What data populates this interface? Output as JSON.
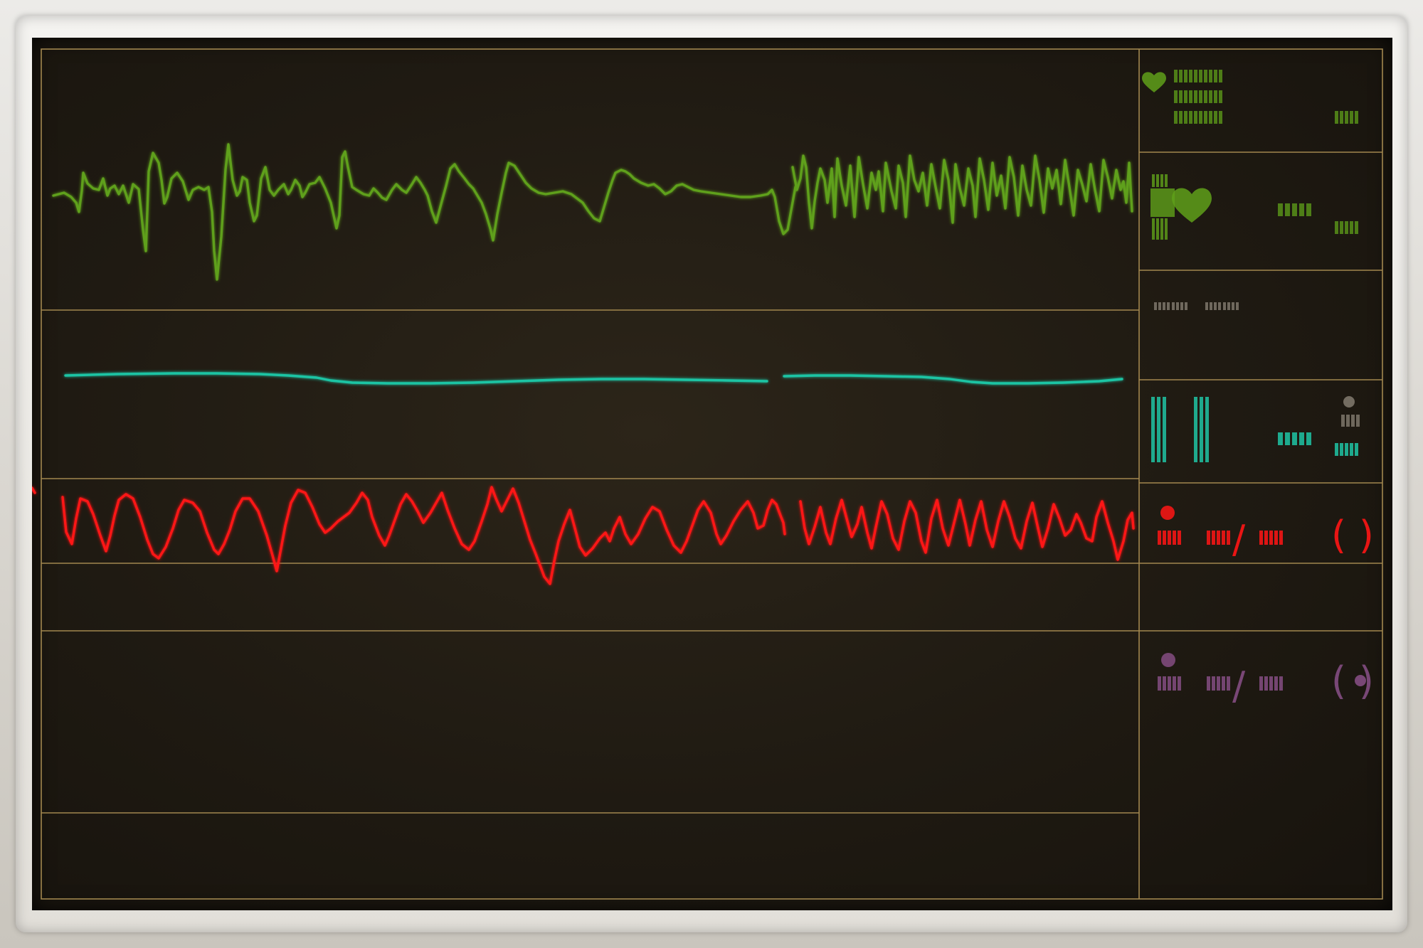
{
  "monitor": {
    "colors": {
      "grid": "#a2874f",
      "ecg": "#5fa01a",
      "spo2": "#1fc4a4",
      "abp": "#ff1515",
      "nibp": "#7e4a7c",
      "gray": "#8a8276"
    },
    "icons": {
      "heart_small": "heart-icon",
      "heart_large": "heart-icon",
      "abp_dot": "dot-icon",
      "nibp_dot": "dot-icon",
      "nibp_inner_dot": "dot-icon"
    },
    "labels": {
      "abp_slash": "/",
      "abp_paren_open": "(",
      "abp_paren_close": ")",
      "nibp_slash": "/",
      "nibp_paren_open": "(",
      "nibp_paren_close": ")"
    }
  }
}
